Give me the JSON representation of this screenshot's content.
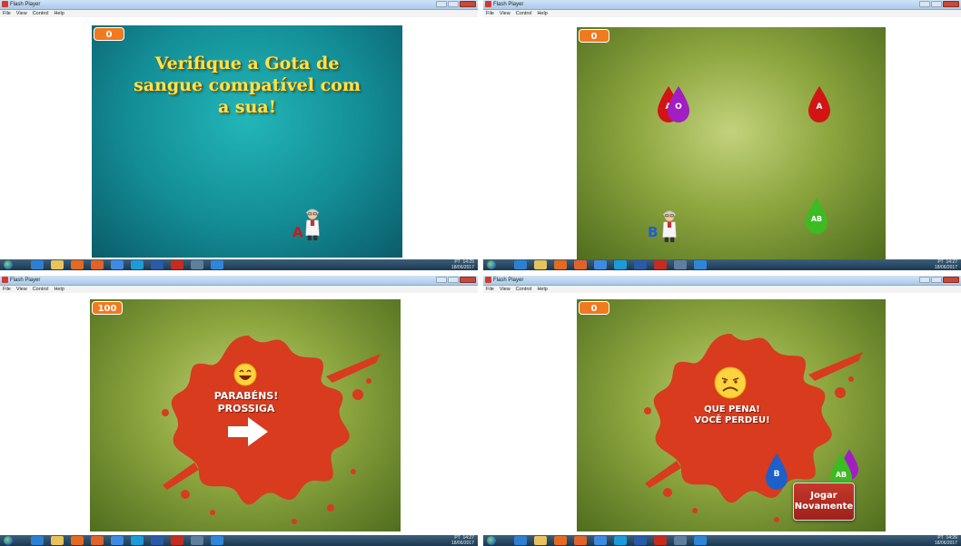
{
  "window": {
    "title": "Flash Player",
    "menu": [
      "File",
      "View",
      "Control",
      "Help"
    ]
  },
  "panels": [
    {
      "score": "0",
      "intro_text": "Verifique a Gota de sangue compatível com a sua!",
      "player_type": "A",
      "clock": "14:25",
      "date": "18/06/2017",
      "lang": "PT"
    },
    {
      "score": "0",
      "player_type": "B",
      "drops": [
        "A",
        "O",
        "A",
        "AB"
      ],
      "clock": "14:27",
      "date": "18/06/2017",
      "lang": "PT"
    },
    {
      "score": "100",
      "message_line1": "PARABÉNS!",
      "message_line2": "PROSSIGA",
      "clock": "14:27",
      "date": "18/06/2017",
      "lang": "PT"
    },
    {
      "score": "0",
      "message_line1": "QUE PENA!",
      "message_line2": "VOCÊ PERDEU!",
      "drops": [
        "B",
        "AB"
      ],
      "replay_line1": "Jogar",
      "replay_line2": "Novamente",
      "clock": "14:26",
      "date": "18/06/2017",
      "lang": "PT"
    }
  ],
  "colors": {
    "drop_red": "#d21414",
    "drop_purple": "#a11ec3",
    "drop_green": "#3dbb22",
    "drop_blue": "#1f5fc8",
    "splat": "#d83b1e",
    "score_orange": "#f07a20"
  }
}
